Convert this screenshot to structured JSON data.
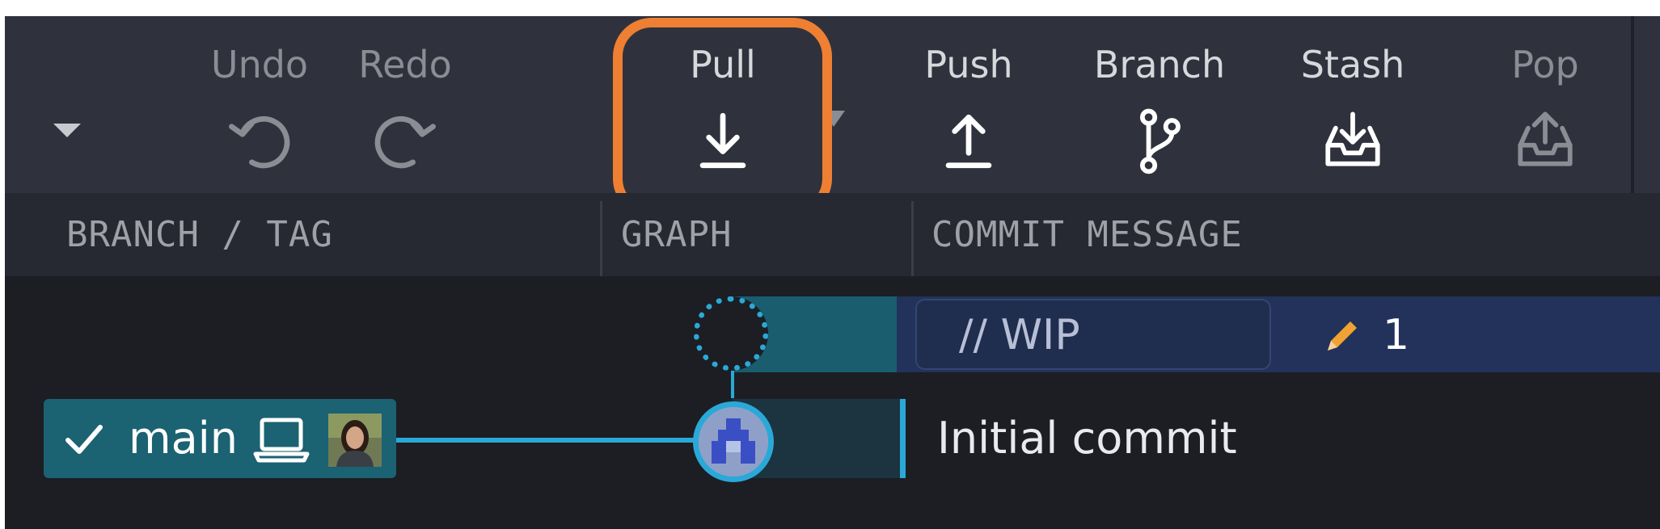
{
  "toolbar": {
    "buttons": [
      {
        "label": "Undo",
        "icon": "undo-icon",
        "enabled": false
      },
      {
        "label": "Redo",
        "icon": "redo-icon",
        "enabled": false
      },
      {
        "label": "Pull",
        "icon": "pull-icon",
        "enabled": true,
        "highlighted": true
      },
      {
        "label": "Push",
        "icon": "push-icon",
        "enabled": true
      },
      {
        "label": "Branch",
        "icon": "branch-icon",
        "enabled": true
      },
      {
        "label": "Stash",
        "icon": "stash-icon",
        "enabled": true
      },
      {
        "label": "Pop",
        "icon": "pop-icon",
        "enabled": false
      }
    ],
    "highlight_color": "#ef7f33"
  },
  "columns": {
    "branch_tag": "BRANCH / TAG",
    "graph": "GRAPH",
    "commit_message": "COMMIT MESSAGE"
  },
  "rows": {
    "wip": {
      "message": "// WIP",
      "changed_files": "1"
    },
    "commit": {
      "message": "Initial commit",
      "branch": "main",
      "checked_out": true
    }
  },
  "colors": {
    "accent": "#2aa9d8",
    "branch_tag_bg": "#1b6272",
    "wip_bg": "#23325a"
  }
}
